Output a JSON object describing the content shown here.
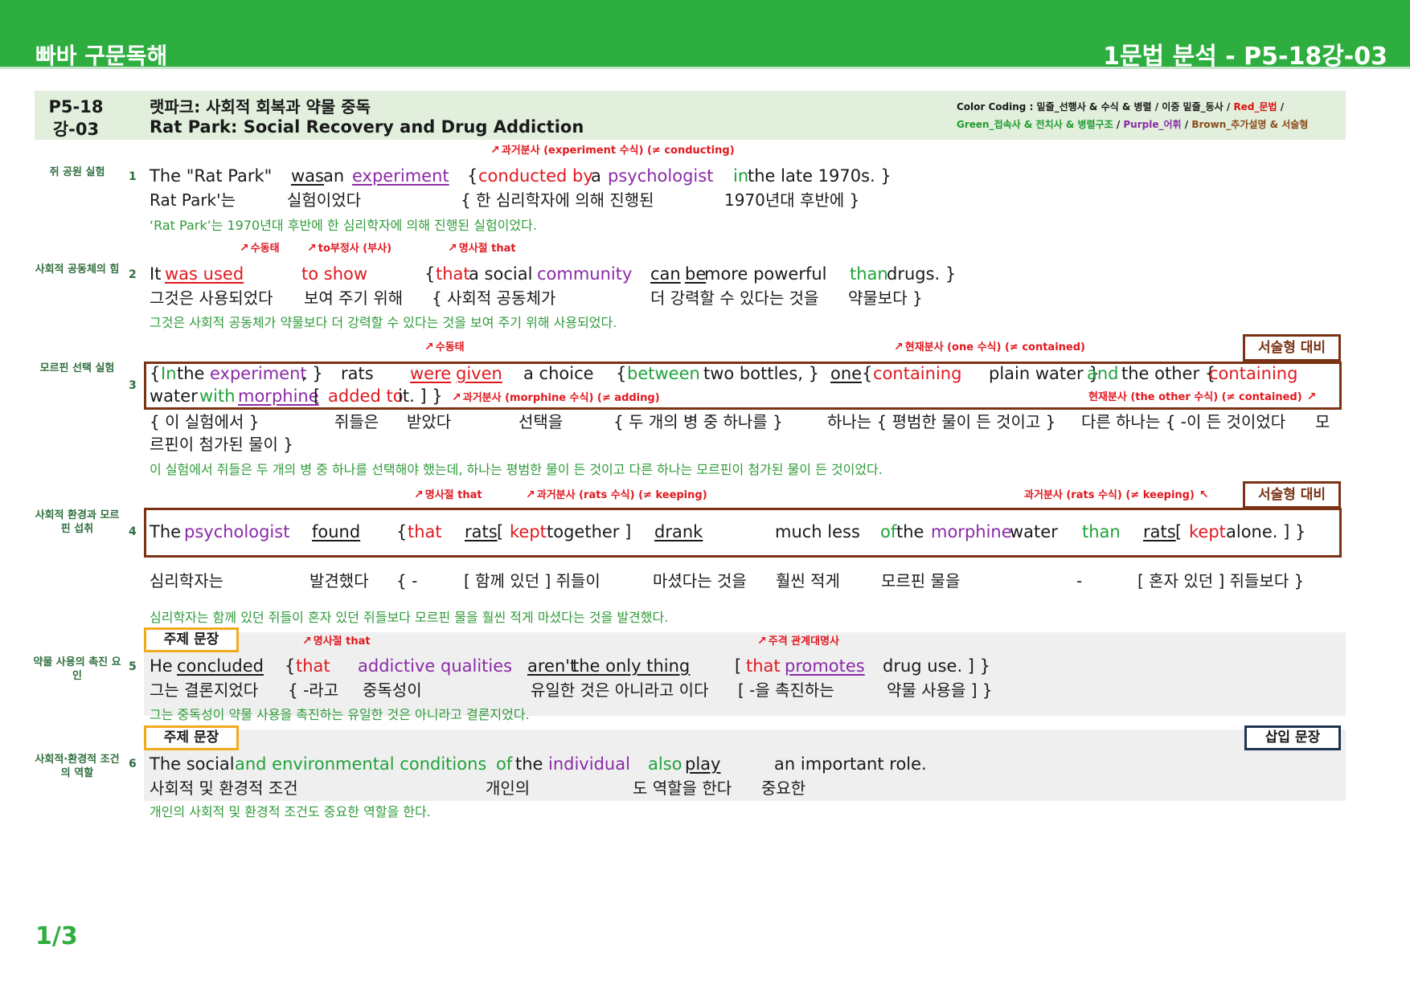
{
  "header": {
    "brand": "빠바 구문독해",
    "code": "1문법 분석 - P5-18강-03"
  },
  "title": {
    "id": "P5-18강-03",
    "korean": "랫파크: 사회적 회복과 약물 중독",
    "english": "Rat Park: Social Recovery and Drug Addiction",
    "legend_line1_a": "Color Coding : 밑줄_선행사 & 수식 & 병렬 / 이중 밑줄_동사 / ",
    "legend_line1_red": "Red_문법",
    "legend_line1_end": " /",
    "legend_line2_green": "Green_접속사 & 전치사 & 병렬구조",
    "legend_sep1": " / ",
    "legend_line2_purple": "Purple_어휘",
    "legend_sep2": " / ",
    "legend_line2_brown": "Brown_추가설명 & 서술형"
  },
  "tags": {
    "essay": "서술형 대비",
    "topic_sentence": "주제 문장",
    "insert_sentence": "삽입 문장"
  },
  "s1": {
    "topic": "쥐 공원 실험",
    "num": "1",
    "note": "과거분사 (experiment 수식) (≠ conducting)",
    "en": {
      "a": "The \"Rat Park\"",
      "b": "was",
      "c": " an ",
      "d": "experiment",
      "e": "{ ",
      "f": "conducted by",
      "g": " a ",
      "h": "psychologist",
      "i": "in",
      "j": " the late 1970s. }"
    },
    "ko": {
      "a": "Rat Park'는",
      "b": "실험이었다",
      "c": "{ 한 심리학자에 의해 진행된",
      "d": "1970년대 후반에 }"
    },
    "tr": "‘Rat Park’는 1970년대 후반에 한 심리학자에 의해 진행된 실험이었다."
  },
  "s2": {
    "topic": "사회적 공동체의 힘",
    "num": "2",
    "notes": {
      "a": "수동태",
      "b": "to부정사 (부사)",
      "c": "명사절 that"
    },
    "en": {
      "a": "It ",
      "b": "was used",
      "c": "to show",
      "d": "{ ",
      "e": "that",
      "f": " a social ",
      "g": "community",
      "h": "can",
      "i": " ",
      "j": "be",
      "k": " more powerful",
      "l": "than",
      "m": " drugs. }"
    },
    "ko": {
      "a": "그것은 사용되었다",
      "b": "보여 주기 위해",
      "c": "{ 사회적 공동체가",
      "d": "더 강력할 수 있다는 것을",
      "e": "약물보다 }"
    },
    "tr": "그것은 사회적 공동체가 약물보다 더 강력할 수 있다는 것을 보여 주기 위해 사용되었다."
  },
  "s3": {
    "topic": "모르핀 선택 실험",
    "num": "3",
    "notes": {
      "a": "수동태",
      "b": "현재분사 (one 수식) (≠ contained)",
      "c": "과거분사 (morphine 수식) (≠ adding)",
      "d": "현재분사 (the other 수식) (≠ contained)"
    },
    "en1": {
      "a": "{ ",
      "b": "In",
      "c": " the ",
      "d": "experiment",
      "e": ", }",
      "f": "rats",
      "g": "were",
      "h": " ",
      "i": "given",
      "j": "a choice",
      "k": "{ ",
      "l": "between",
      "m": " two bottles, }",
      "n": "one",
      "o": " { ",
      "p": "containing",
      "q": " plain water }",
      "r": "and",
      "s": " the other { ",
      "t": "containing"
    },
    "en2": {
      "a": "water ",
      "b": "with",
      "c": " ",
      "d": "morphine",
      "e": " [ ",
      "f": "added to",
      "g": " it. ] }"
    },
    "ko1": {
      "a": "{ 이 실험에서 }",
      "b": "쥐들은",
      "c": "받았다",
      "d": "선택을",
      "e": "{ 두 개의 병 중 하나를 }",
      "f": "하나는 { 평범한 물이 든 것이고 }",
      "g": "다른 하나는 { -이 든 것이었다",
      "h": "모"
    },
    "ko2": "르핀이 첨가된 물이 }",
    "tr": "이 실험에서 쥐들은 두 개의 병 중 하나를 선택해야 했는데, 하나는 평범한 물이 든 것이고 다른 하나는 모르핀이 첨가된 물이 든 것이었다."
  },
  "s4": {
    "topic": "사회적 환경과 모르핀 섭취",
    "num": "4",
    "notes": {
      "a": "명사절 that",
      "b": "과거분사 (rats 수식) (≠ keeping)",
      "c": "과거분사 (rats 수식) (≠ keeping)"
    },
    "en": {
      "a": "The ",
      "b": "psychologist",
      "c": "found",
      "d": "{ ",
      "e": "that",
      "f": "rats",
      "g": " [ ",
      "h": "kept",
      "i": " together ]",
      "j": "drank",
      "k": "much less",
      "l": "of",
      "m": " the ",
      "n": "morphine",
      "o": " water",
      "p": "than",
      "q": "rats",
      "r": " [ ",
      "s": "kept",
      "t": " alone. ] }"
    },
    "ko": {
      "a": "심리학자는",
      "b": "발견했다",
      "c": "{ -",
      "d": "[ 함께 있던 ] 쥐들이",
      "e": "마셨다는 것을",
      "f": "훨씬 적게",
      "g": "모르핀 물을",
      "h": "-",
      "i": "[ 혼자 있던 ] 쥐들보다 }"
    },
    "tr": "심리학자는 함께 있던 쥐들이 혼자 있던 쥐들보다 모르핀 물을 훨씬 적게 마셨다는 것을 발견했다."
  },
  "s5": {
    "topic": "약물 사용의 촉진 요인",
    "num": "5",
    "notes": {
      "a": "명사절 that",
      "b": "주격 관계대명사"
    },
    "en": {
      "a": "He ",
      "b": "concluded",
      "c": "{ ",
      "d": "that",
      "e": "addictive qualities",
      "f": "aren't",
      "g": " the only thing",
      "h": "[ ",
      "i": "that",
      "j": " ",
      "k": "promotes",
      "l": "drug use. ] }"
    },
    "ko": {
      "a": "그는 결론지었다",
      "b": "{ -라고",
      "c": "중독성이",
      "d": "유일한 것은 아니라고 이다",
      "e": "[ -을 촉진하는",
      "f": "약물 사용을 ] }"
    },
    "tr": "그는 중독성이 약물 사용을 촉진하는 유일한 것은 아니라고 결론지었다."
  },
  "s6": {
    "topic": "사회적·환경적 조건의 역할",
    "num": "6",
    "en": {
      "a": "The social ",
      "b": "and environmental conditions",
      "c": "of",
      "d": " the ",
      "e": "individual",
      "f": "also",
      "g": " ",
      "h": "play",
      "i": "an important role."
    },
    "ko": {
      "a": "사회적 및 환경적 조건",
      "b": "개인의",
      "c": "도 역할을 한다",
      "d": "중요한"
    },
    "tr": "개인의 사회적 및 환경적 조건도 중요한 역할을 한다."
  },
  "footer": {
    "page": "1/3"
  }
}
